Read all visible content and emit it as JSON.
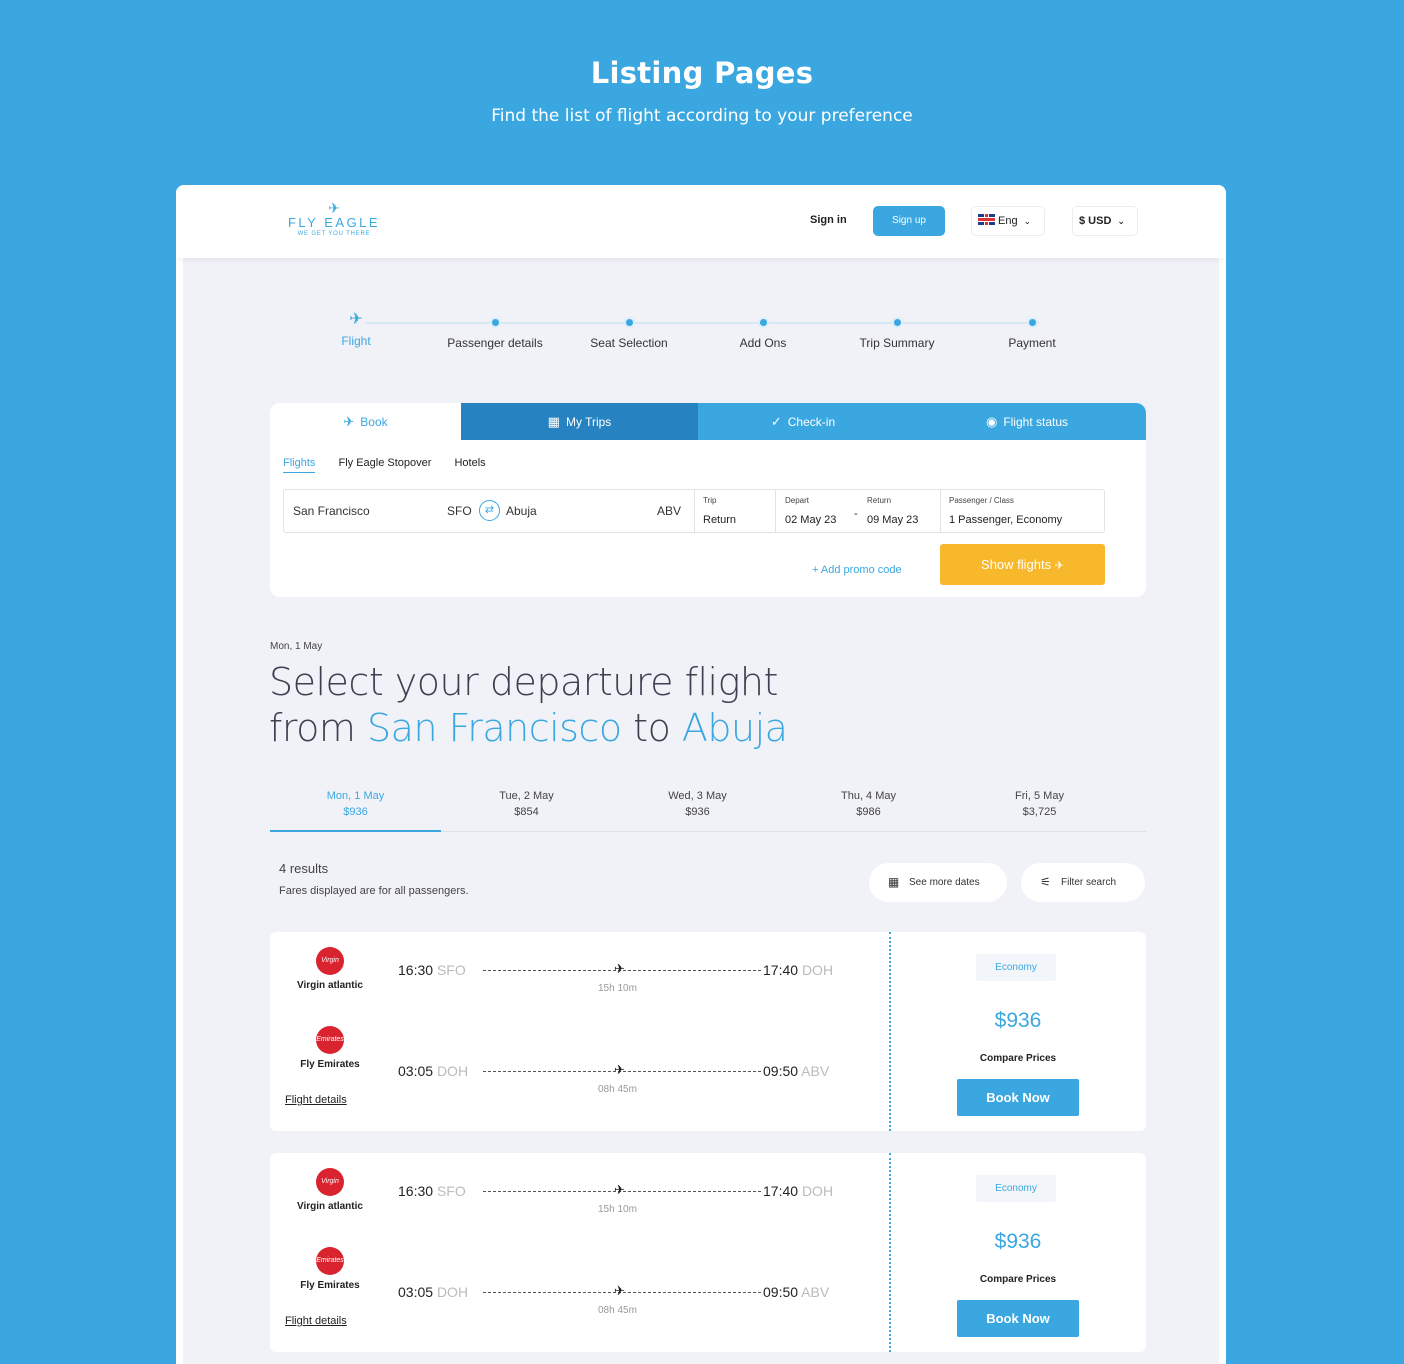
{
  "hero": {
    "title": "Listing Pages",
    "subtitle": "Find the list of flight according to your preference"
  },
  "navbar": {
    "logo_name": "FLY EAGLE",
    "logo_tagline": "WE GET YOU THERE",
    "sign_in": "Sign in",
    "sign_up": "Sign up",
    "language": "Eng",
    "currency": "$ USD"
  },
  "stepper": {
    "steps": [
      "Flight",
      "Passenger details",
      "Seat Selection",
      "Add Ons",
      "Trip Summary",
      "Payment"
    ],
    "active_index": 0
  },
  "search": {
    "tabs": [
      "Book",
      "My Trips",
      "Check-in",
      "Flight status"
    ],
    "subtabs": [
      "Flights",
      "Fly Eagle Stopover",
      "Hotels"
    ],
    "from_city": "San Francisco",
    "from_code": "SFO",
    "to_city": "Abuja",
    "to_code": "ABV",
    "trip_label": "Trip",
    "trip_value": "Return",
    "depart_label": "Depart",
    "depart_value": "02 May 23",
    "return_label": "Return",
    "return_value": "09 May 23",
    "passenger_label": "Passenger / Class",
    "passenger_value": "1 Passenger, Economy",
    "promo": "+ Add promo code",
    "show_flights": "Show flights"
  },
  "listing": {
    "date": "Mon, 1 May",
    "headline_1": "Select your departure flight",
    "headline_from_word": "from",
    "headline_from": "San Francisco",
    "headline_to_word": "to",
    "headline_to": "Abuja",
    "date_tabs": [
      {
        "day": "Mon, 1 May",
        "price": "$936"
      },
      {
        "day": "Tue, 2 May",
        "price": "$854"
      },
      {
        "day": "Wed, 3 May",
        "price": "$936"
      },
      {
        "day": "Thu, 4 May",
        "price": "$986"
      },
      {
        "day": "Fri, 5 May",
        "price": "$3,725"
      }
    ],
    "results_count": "4 results",
    "fares_note": "Fares displayed are for all passengers.",
    "see_more_dates": "See more dates",
    "filter_search": "Filter search"
  },
  "flights": [
    {
      "airline_1": "Virgin atlantic",
      "airline_2": "Fly Emirates",
      "details_link": "Flight details",
      "leg1": {
        "dep_time": "16:30",
        "dep_code": "SFO",
        "arr_time": "17:40",
        "arr_code": "DOH",
        "duration": "15h 10m"
      },
      "leg2": {
        "dep_time": "03:05",
        "dep_code": "DOH",
        "arr_time": "09:50",
        "arr_code": "ABV",
        "duration": "08h 45m"
      },
      "class": "Economy",
      "price": "$936",
      "compare": "Compare Prices",
      "book": "Book Now"
    },
    {
      "airline_1": "Virgin atlantic",
      "airline_2": "Fly Emirates",
      "details_link": "Flight details",
      "leg1": {
        "dep_time": "16:30",
        "dep_code": "SFO",
        "arr_time": "17:40",
        "arr_code": "DOH",
        "duration": "15h 10m"
      },
      "leg2": {
        "dep_time": "03:05",
        "dep_code": "DOH",
        "arr_time": "09:50",
        "arr_code": "ABV",
        "duration": "08h 45m"
      },
      "class": "Economy",
      "price": "$936",
      "compare": "Compare Prices",
      "book": "Book Now"
    }
  ],
  "colors": {
    "background": "#3ba7e0",
    "accent": "#3ba7e0",
    "cta": "#f8b82c",
    "tab_dark": "#2682c1"
  }
}
